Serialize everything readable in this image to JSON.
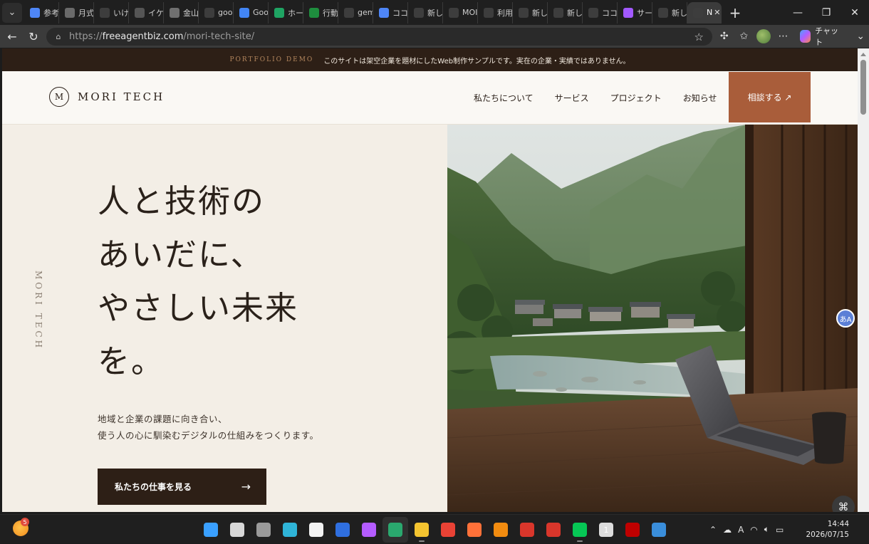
{
  "browser": {
    "tabs": [
      {
        "label": "参考",
        "icon_name": "gemini-icon",
        "color": "#4e86f7"
      },
      {
        "label": "月式",
        "icon_name": "page-thumbnail-icon",
        "color": "#6a6a6a"
      },
      {
        "label": "いけた",
        "icon_name": "search-icon",
        "color": "#3d3d3d"
      },
      {
        "label": "イケ",
        "icon_name": "page-grid-icon",
        "color": "#555555"
      },
      {
        "label": "金山",
        "icon_name": "page-thumbnail-icon",
        "color": "#707070"
      },
      {
        "label": "goo",
        "icon_name": "search-icon",
        "color": "#3d3d3d"
      },
      {
        "label": "Goo",
        "icon_name": "google-icon",
        "color": "#4285f4"
      },
      {
        "label": "ホー",
        "icon_name": "drive-icon",
        "color": "#1fa463"
      },
      {
        "label": "行動",
        "icon_name": "sheets-icon",
        "color": "#1e8e3e"
      },
      {
        "label": "gem",
        "icon_name": "search-icon",
        "color": "#3d3d3d"
      },
      {
        "label": "ココ",
        "icon_name": "gemini-icon",
        "color": "#4e86f7"
      },
      {
        "label": "新し",
        "icon_name": "newtab-icon",
        "color": "#3d3d3d"
      },
      {
        "label": "MOI",
        "icon_name": "globe-icon",
        "color": "#3d3d3d"
      },
      {
        "label": "利用",
        "icon_name": "openai-icon",
        "color": "#3d3d3d"
      },
      {
        "label": "新し",
        "icon_name": "newtab-icon",
        "color": "#3d3d3d"
      },
      {
        "label": "新し",
        "icon_name": "newtab-icon",
        "color": "#3d3d3d"
      },
      {
        "label": "ココ",
        "icon_name": "search-icon",
        "color": "#3d3d3d"
      },
      {
        "label": "サー",
        "icon_name": "figma-icon",
        "color": "#a259ff"
      },
      {
        "label": "新し",
        "icon_name": "newtab-icon",
        "color": "#3d3d3d"
      },
      {
        "label": "N",
        "icon_name": "globe-icon",
        "color": "#3d3d3d",
        "active": true
      }
    ],
    "url": {
      "prefix": "https://",
      "host": "freeagentbiz.com",
      "path": "/mori-tech-site/"
    },
    "copilot_label": "チャット"
  },
  "site": {
    "banner": {
      "tag": "PORTFOLIO DEMO",
      "text": "このサイトは架空企業を題材にしたWeb制作サンプルです。実在の企業・実績ではありません。"
    },
    "logo": {
      "mark": "M",
      "name": "MORI TECH"
    },
    "nav": [
      "私たちについて",
      "サービス",
      "プロジェクト",
      "お知らせ"
    ],
    "cta_label": "相談する ↗",
    "vertical_brand": "MORI TECH",
    "headline_lines": [
      "人と技術の",
      "あいだに、",
      "やさしい未来",
      "を。"
    ],
    "lead_lines": [
      "地域と企業の課題に向き合い、",
      "使う人の心に馴染むデジタルの仕組みをつくります。"
    ],
    "primary_button": {
      "label": "私たちの仕事を見る",
      "arrow": "→"
    },
    "hero_image_alt": "山あいの集落と川を望む窓辺の木の机に置かれたノートパソコン"
  },
  "floating": {
    "translate_icon": "translate-icon",
    "cmd_icon": "command-icon",
    "bot_icon": "assistant-bot-icon"
  },
  "taskbar": {
    "weather_badge": "5",
    "apps": [
      {
        "icon_name": "windows-start-icon",
        "color": "#3aa0ff"
      },
      {
        "icon_name": "search-icon",
        "color": "#d8d8d8"
      },
      {
        "icon_name": "task-view-icon",
        "color": "#9a9a9a"
      },
      {
        "icon_name": "copilot-swirl-icon",
        "color": "#2fb4d8"
      },
      {
        "icon_name": "store-icon",
        "color": "#f2f2f2"
      },
      {
        "icon_name": "todo-icon",
        "color": "#2f6fe0"
      },
      {
        "icon_name": "copilot-icon",
        "color": "#b45cff"
      },
      {
        "icon_name": "edge-icon",
        "color": "#2aa86e",
        "active": true
      },
      {
        "icon_name": "file-explorer-icon",
        "color": "#f4c430",
        "running": true
      },
      {
        "icon_name": "chrome-icon",
        "color": "#e94235"
      },
      {
        "icon_name": "firefox-icon",
        "color": "#ff7139"
      },
      {
        "icon_name": "vlc-icon",
        "color": "#f28c10"
      },
      {
        "icon_name": "wps-icon",
        "color": "#d9362b"
      },
      {
        "icon_name": "pdf-icon",
        "color": "#d9362b"
      },
      {
        "icon_name": "line-icon",
        "color": "#06c755",
        "running": true
      },
      {
        "icon_name": "chatgpt-icon",
        "color": "#dddddd",
        "badge": "1"
      },
      {
        "icon_name": "filezilla-icon",
        "color": "#bf0000"
      },
      {
        "icon_name": "notepad-icon",
        "color": "#3a8edb"
      }
    ],
    "tray_icons": [
      "chevron-up-icon",
      "onedrive-icon",
      "ime-icon",
      "wifi-icon",
      "volume-icon",
      "battery-icon"
    ],
    "ime_label": "A",
    "time": "14:44",
    "date": "2026/07/15"
  }
}
